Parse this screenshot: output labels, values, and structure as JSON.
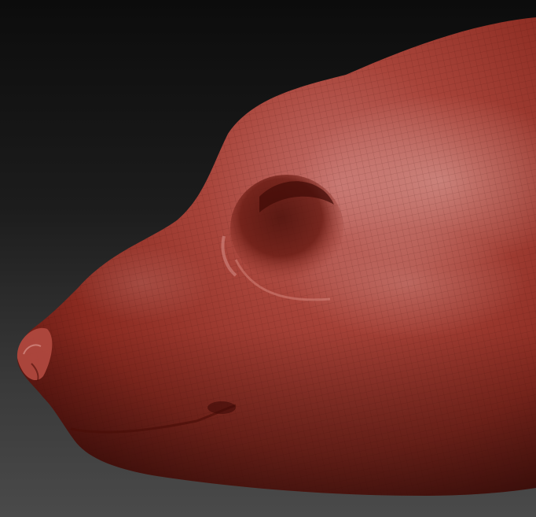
{
  "viewport": {
    "background_top": "#0c0c0c",
    "background_bottom": "#4a4a4a"
  },
  "model": {
    "subject": "sculpted-animal-head-icon",
    "material_color": "#a8352a",
    "material_highlight": "#d89a92",
    "material_shadow": "#5e1610",
    "wireframe_visible": true
  }
}
